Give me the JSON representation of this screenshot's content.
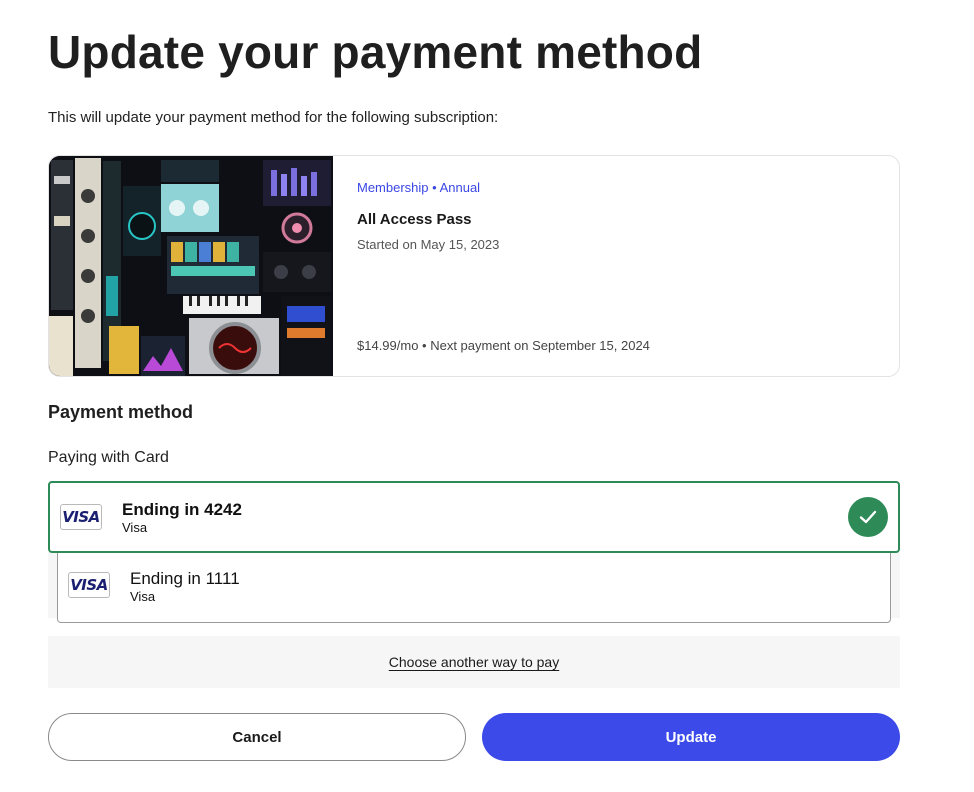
{
  "page": {
    "title": "Update your payment method",
    "intro": "This will update your payment method for the following subscription:"
  },
  "subscription": {
    "tag": "Membership • Annual",
    "name": "All Access Pass",
    "started": "Started on May 15, 2023",
    "price_line": "$14.99/mo • Next payment on September 15, 2024",
    "image_icon": "plugin-collage-image"
  },
  "payment": {
    "section_title": "Payment method",
    "paying_with": "Paying with Card",
    "cards": [
      {
        "ending": "Ending in 4242",
        "brand": "Visa",
        "logo": "VISA",
        "selected": true
      },
      {
        "ending": "Ending in 1111",
        "brand": "Visa",
        "logo": "VISA",
        "selected": false
      }
    ],
    "another_way": "Choose another way to pay"
  },
  "actions": {
    "cancel_label": "Cancel",
    "update_label": "Update"
  },
  "colors": {
    "accent": "#3b4ae8",
    "selected_border": "#2e8b57",
    "tag_text": "#3a47e3"
  }
}
